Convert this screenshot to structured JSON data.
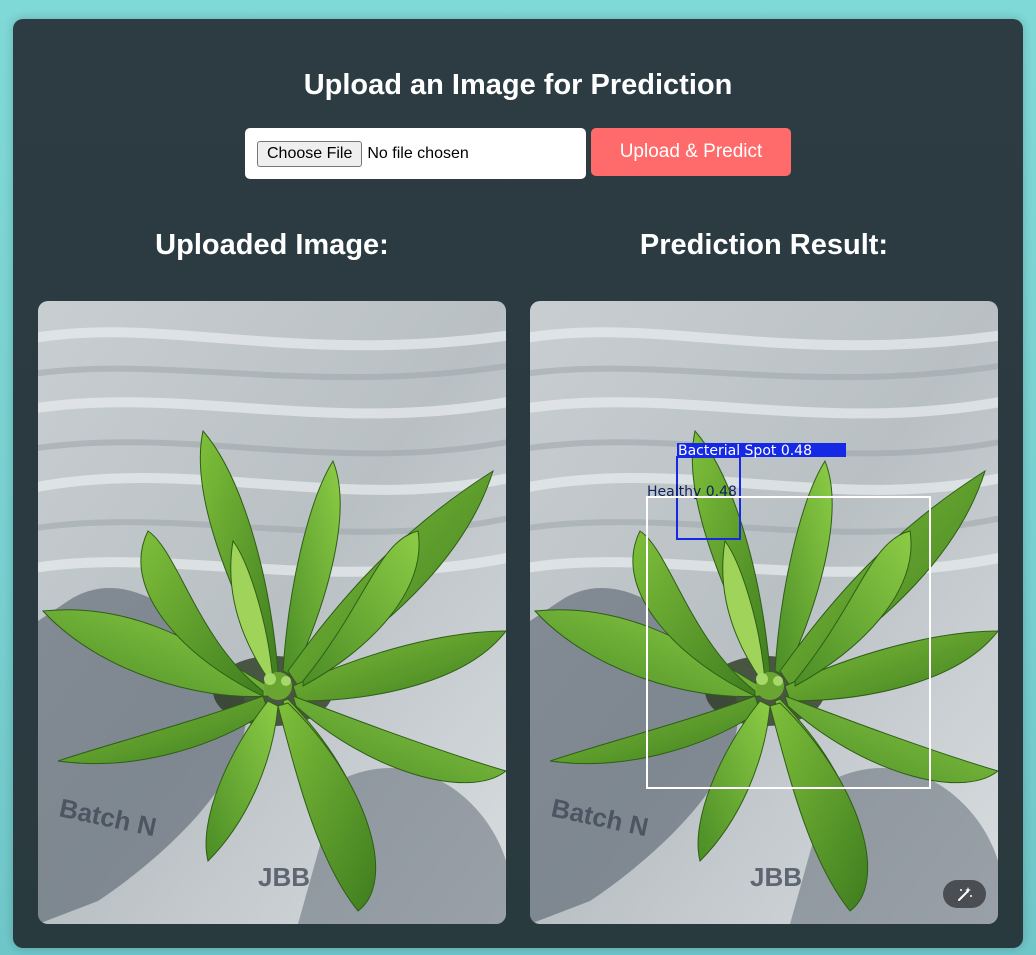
{
  "page": {
    "title": "Upload an Image for Prediction"
  },
  "upload": {
    "choose_button_label": "Choose File",
    "file_status": "No file chosen",
    "submit_label": "Upload & Predict"
  },
  "uploaded": {
    "heading": "Uploaded Image:"
  },
  "result": {
    "heading": "Prediction Result:",
    "detections": [
      {
        "label": "Bacterial Spot 0.48",
        "color": "#1428e6"
      },
      {
        "label": "Healthy 0.48",
        "color": "#ffffff"
      }
    ]
  },
  "image_text": {
    "batch": "Batch N",
    "code": "JBB"
  },
  "icons": {
    "edit": "magic-wand-icon"
  },
  "colors": {
    "accent_button": "#ff6b6b",
    "panel_bg": "#2c3c42",
    "page_bg": "#7fd9d6"
  }
}
